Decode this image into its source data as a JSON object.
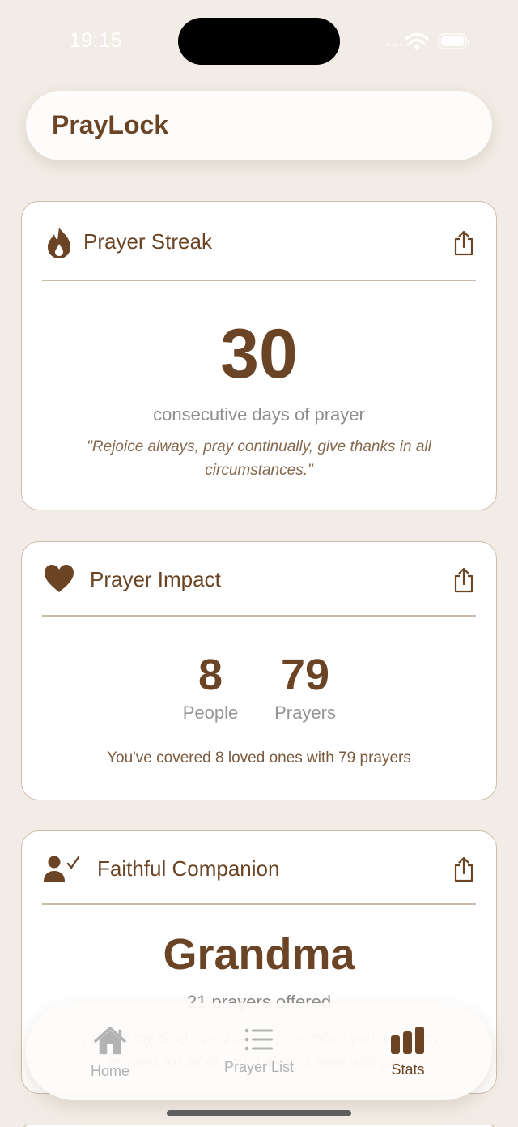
{
  "status_bar": {
    "time": "19:15",
    "icons": [
      "cellular-signal-icon",
      "wifi-icon",
      "battery-icon"
    ]
  },
  "header": {
    "title": "PrayLock"
  },
  "colors": {
    "accent": "#6a4424",
    "background": "#f1ede6",
    "card_border": "#cdbda8",
    "muted_text": "#8e8e8e",
    "inactive_tab": "#b3b3b3"
  },
  "cards": {
    "streak": {
      "icon": "flame-icon",
      "title": "Prayer Streak",
      "share_icon": "share-icon",
      "value": "30",
      "caption": "consecutive days of prayer",
      "quote": "\"Rejoice always, pray continually, give thanks in all circumstances.\""
    },
    "impact": {
      "icon": "heart-icon",
      "title": "Prayer Impact",
      "share_icon": "share-icon",
      "stats": [
        {
          "value": "8",
          "label": "People"
        },
        {
          "value": "79",
          "label": "Prayers"
        }
      ],
      "summary": "You've covered 8 loved ones with 79 prayers"
    },
    "companion": {
      "icon": "person-checkmark-icon",
      "title": "Faithful Companion",
      "share_icon": "share-icon",
      "name": "Grandma",
      "caption": "21 prayers offered",
      "quote": "\"I thank my God every time I remember you. In all my prayers for all of you, I always pray with joy.\""
    }
  },
  "tabbar": {
    "tabs": [
      {
        "label": "Home",
        "icon": "house-icon",
        "active": false
      },
      {
        "label": "Prayer List",
        "icon": "list-icon",
        "active": false
      },
      {
        "label": "Stats",
        "icon": "bar-chart-icon",
        "active": true
      }
    ]
  }
}
